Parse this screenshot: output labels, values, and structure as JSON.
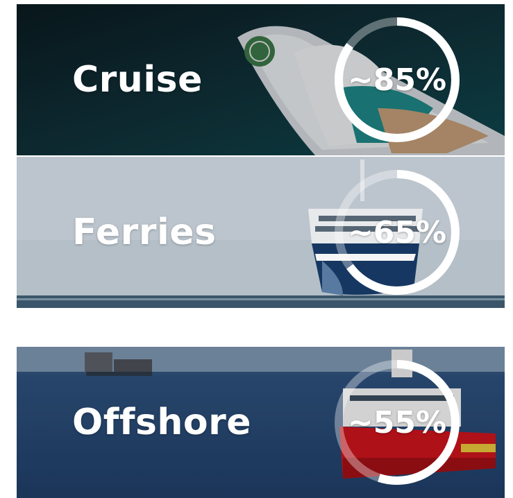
{
  "segments": [
    {
      "label": "Cruise",
      "percent_text": "~85%",
      "share": 0.85,
      "image": "cruise-ship-aerial"
    },
    {
      "label": "Ferries",
      "percent_text": "~65%",
      "share": 0.65,
      "image": "ferry-at-sea"
    },
    {
      "label": "Offshore",
      "percent_text": "~55%",
      "share": 0.55,
      "image": "offshore-supply-vessel"
    }
  ],
  "colors": {
    "ring_fill": "#ffffff",
    "ring_track": "rgba(255,255,255,0.35)",
    "text": "#ffffff"
  }
}
